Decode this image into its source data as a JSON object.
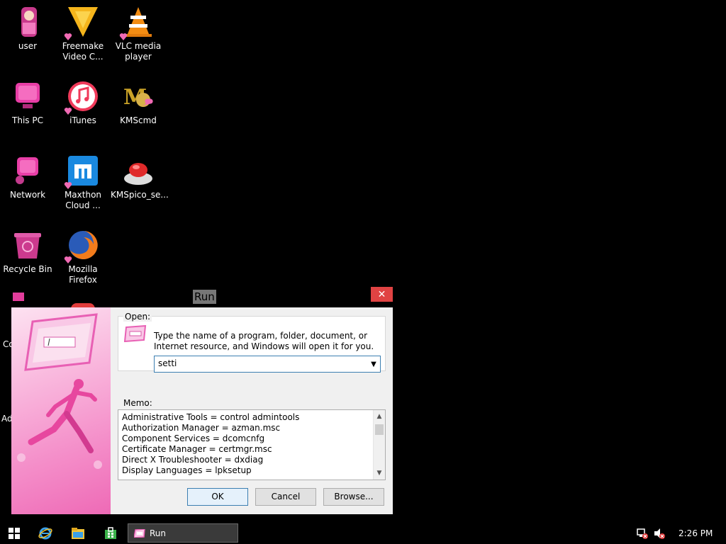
{
  "desktop": {
    "icons": [
      {
        "label": "user",
        "icon": "user-icon"
      },
      {
        "label": "Freemake Video C...",
        "icon": "freemake-icon"
      },
      {
        "label": "VLC media player",
        "icon": "vlc-icon"
      },
      {
        "label": "This PC",
        "icon": "this-pc-icon"
      },
      {
        "label": "iTunes",
        "icon": "itunes-icon"
      },
      {
        "label": "KMScmd",
        "icon": "kmscmd-icon"
      },
      {
        "label": "Network",
        "icon": "network-icon"
      },
      {
        "label": "Maxthon Cloud ...",
        "icon": "maxthon-icon"
      },
      {
        "label": "KMSpico_se...",
        "icon": "kmspico-icon"
      },
      {
        "label": "Recycle Bin",
        "icon": "recycle-bin-icon"
      },
      {
        "label": "Mozilla Firefox",
        "icon": "firefox-icon"
      }
    ],
    "partial_labels": [
      "Co",
      "Ad"
    ]
  },
  "run_dialog": {
    "title": "Run",
    "open_label": "Open:",
    "description": "Type the name of a program, folder, document, or Internet resource, and Windows will open it for you.",
    "open_value": "setti",
    "memo_label": "Memo:",
    "memo_items": [
      "Administrative Tools = control admintools",
      "Authorization Manager = azman.msc",
      "Component Services = dcomcnfg",
      "Certificate Manager = certmgr.msc",
      "Direct X Troubleshooter = dxdiag",
      "Display Languages = lpksetup"
    ],
    "buttons": {
      "ok": "OK",
      "cancel": "Cancel",
      "browse": "Browse..."
    }
  },
  "taskbar": {
    "active_app": "Run",
    "time": "2:26 PM"
  },
  "colors": {
    "accent_pink": "#f48cc8",
    "close_red": "#e04343"
  }
}
